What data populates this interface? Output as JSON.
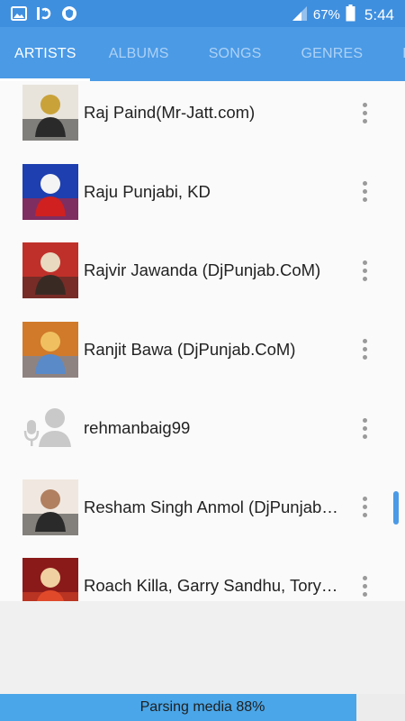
{
  "status_bar": {
    "icons": [
      "image-icon",
      "sync-icon",
      "shield-icon"
    ],
    "signal_icon": "signal-icon",
    "battery_percent": "67%",
    "battery_icon": "battery-icon",
    "time": "5:44"
  },
  "tabs": [
    "ARTISTS",
    "ALBUMS",
    "SONGS",
    "GENRES",
    "PLAYL"
  ],
  "active_tab": "ARTISTS",
  "artists": [
    {
      "name": "Raj Paind(Mr-Jatt.com)",
      "art": "album-art",
      "colors": [
        "#e8e4dc",
        "#2a2a2a",
        "#c9a23a"
      ]
    },
    {
      "name": "Raju Punjabi, KD",
      "art": "album-art",
      "colors": [
        "#1d3fb0",
        "#d02020",
        "#f4f4f4"
      ]
    },
    {
      "name": "Rajvir Jawanda (DjPunjab.CoM)",
      "art": "album-art",
      "colors": [
        "#c0302a",
        "#3a2a24",
        "#e8d9c0"
      ]
    },
    {
      "name": "Ranjit Bawa (DjPunjab.CoM)",
      "art": "album-art",
      "colors": [
        "#d07a2a",
        "#5a8ac8",
        "#f0c060"
      ]
    },
    {
      "name": "rehmanbaig99",
      "art": "default-artist-icon",
      "colors": [
        "#c9c9c9"
      ]
    },
    {
      "name": "Resham Singh Anmol (DjPunjab…",
      "art": "album-art",
      "colors": [
        "#f0e8e0",
        "#2a2a2a",
        "#b08060"
      ]
    },
    {
      "name": "Roach Killa, Garry Sandhu, Tory…",
      "art": "album-art",
      "colors": [
        "#8a1a1a",
        "#e04a2a",
        "#f0d0a0"
      ]
    }
  ],
  "progress": {
    "label": "Parsing media 88%",
    "percent": 88
  },
  "accent_color": "#4a9ae6"
}
